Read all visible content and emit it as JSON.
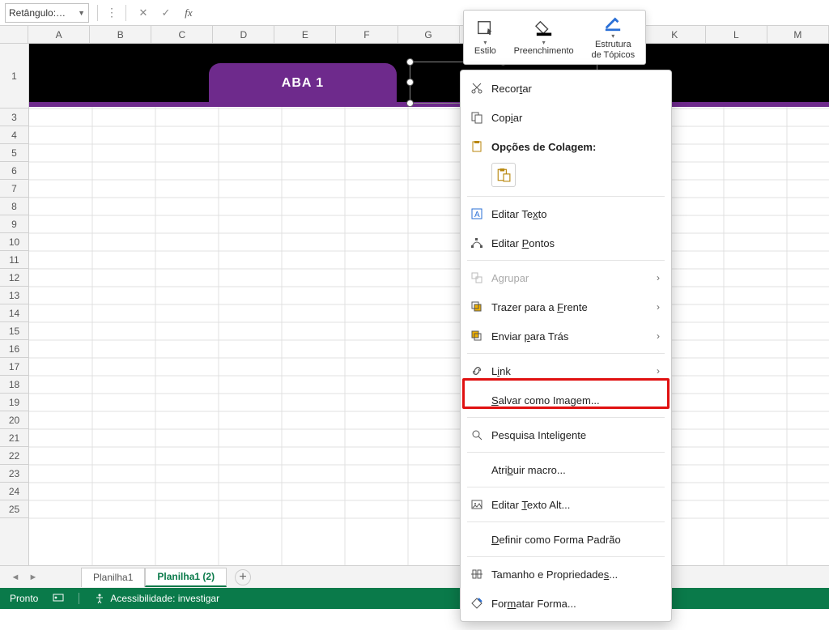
{
  "formula_bar": {
    "name_box": "Retângulo:…",
    "fx_label": "fx"
  },
  "columns": [
    "A",
    "B",
    "C",
    "D",
    "E",
    "F",
    "G",
    "",
    "",
    "",
    "K",
    "L",
    "M"
  ],
  "rows_first": "1",
  "rows": [
    "3",
    "4",
    "5",
    "6",
    "7",
    "8",
    "9",
    "10",
    "11",
    "12",
    "13",
    "14",
    "15",
    "16",
    "17",
    "18",
    "19",
    "20",
    "21",
    "22",
    "23",
    "24",
    "25"
  ],
  "shapes": {
    "tab1_label": "ABA 1"
  },
  "float_toolbar": {
    "style": "Estilo",
    "fill": "Preenchimento",
    "outline": "Estrutura\nde Tópicos"
  },
  "context_menu": {
    "cut": "Recortar",
    "copy": "Copiar",
    "paste_options": "Opções de Colagem:",
    "edit_text": "Editar Texto",
    "edit_points": "Editar Pontos",
    "group": "Agrupar",
    "bring_front": "Trazer para a Frente",
    "send_back": "Enviar para Trás",
    "link": "Link",
    "save_as_image": "Salvar como Imagem...",
    "smart_lookup": "Pesquisa Inteligente",
    "assign_macro": "Atribuir macro...",
    "alt_text": "Editar Texto Alt...",
    "default_shape": "Definir como Forma Padrão",
    "size_props": "Tamanho e Propriedades...",
    "format_shape": "Formatar Forma..."
  },
  "sheet_tabs": {
    "tab1": "Planilha1",
    "tab2": "Planilha1  (2)"
  },
  "status_bar": {
    "ready": "Pronto",
    "accessibility": "Acessibilidade: investigar"
  }
}
